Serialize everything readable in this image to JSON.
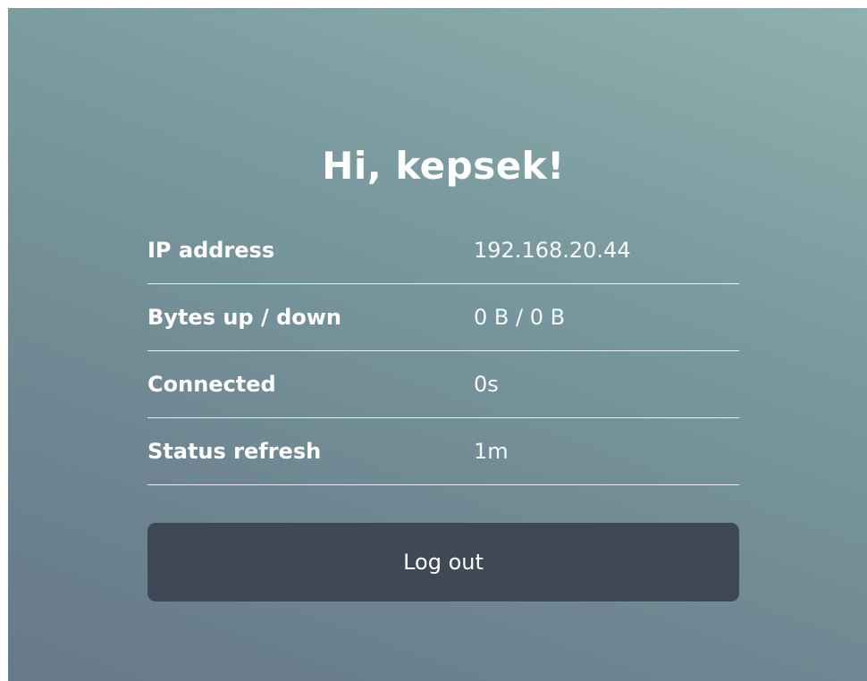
{
  "greeting": "Hi, kepsek!",
  "info": {
    "rows": [
      {
        "label": "IP address",
        "value": "192.168.20.44"
      },
      {
        "label": "Bytes up / down",
        "value": "0 B / 0 B"
      },
      {
        "label": "Connected",
        "value": "0s"
      },
      {
        "label": "Status refresh",
        "value": "1m"
      }
    ]
  },
  "actions": {
    "logout_label": "Log out"
  },
  "colors": {
    "button_background": "#3e4955",
    "text": "#ffffff"
  }
}
